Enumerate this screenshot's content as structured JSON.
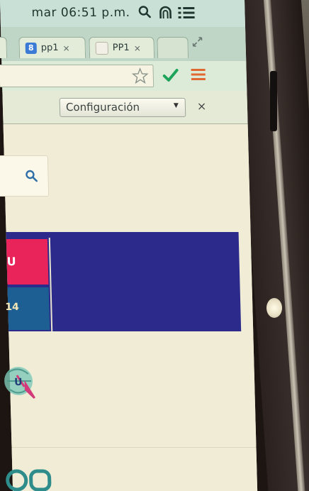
{
  "status_bar": {
    "time": "mar 06:51 p.m.",
    "icons": [
      "search-icon",
      "notification-icon",
      "menu-icon"
    ]
  },
  "tabs": [
    {
      "label": "pp1",
      "favicon": "8",
      "favicon_color": "#3b7bd5",
      "close": "×"
    },
    {
      "label": "PP1",
      "favicon": "",
      "favicon_color": "#f2f0e6",
      "close": "×"
    }
  ],
  "toolbar": {
    "icons": [
      "star-icon",
      "check-icon",
      "menu-icon"
    ],
    "accent": "#1ea35a",
    "menu_color": "#e0672f"
  },
  "findbar": {
    "select_value": "Configuración",
    "close": "×"
  },
  "page": {
    "tile_1_text": "U",
    "tile_2_text": "14",
    "colors": {
      "banner": "#2c2b8c",
      "tile_pink": "#e8245a",
      "tile_blue": "#1e5f93"
    }
  }
}
